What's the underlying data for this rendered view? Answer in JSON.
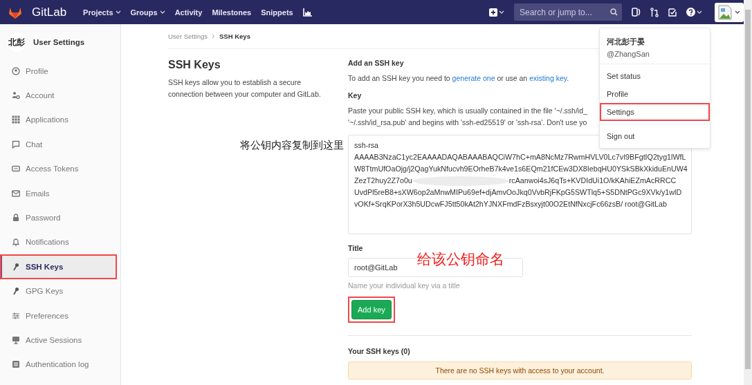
{
  "navbar": {
    "brand": "GitLab",
    "links": [
      {
        "label": "Projects",
        "dropdown": true
      },
      {
        "label": "Groups",
        "dropdown": true
      },
      {
        "label": "Activity",
        "dropdown": false
      },
      {
        "label": "Milestones",
        "dropdown": false
      },
      {
        "label": "Snippets",
        "dropdown": false
      }
    ],
    "search": {
      "placeholder": "Search or jump to..."
    }
  },
  "sidebar": {
    "avatar_text": "北彭",
    "title": "User Settings",
    "items": [
      {
        "label": "Profile",
        "kind": "profile",
        "selected": false,
        "annotated": false
      },
      {
        "label": "Account",
        "kind": "account",
        "selected": false,
        "annotated": false
      },
      {
        "label": "Applications",
        "kind": "applications",
        "selected": false,
        "annotated": false
      },
      {
        "label": "Chat",
        "kind": "chat",
        "selected": false,
        "annotated": false
      },
      {
        "label": "Access Tokens",
        "kind": "token",
        "selected": false,
        "annotated": false
      },
      {
        "label": "Emails",
        "kind": "email",
        "selected": false,
        "annotated": false
      },
      {
        "label": "Password",
        "kind": "lock",
        "selected": false,
        "annotated": false
      },
      {
        "label": "Notifications",
        "kind": "bell",
        "selected": false,
        "annotated": false
      },
      {
        "label": "SSH Keys",
        "kind": "key",
        "selected": true,
        "annotated": true
      },
      {
        "label": "GPG Keys",
        "kind": "key",
        "selected": false,
        "annotated": false
      },
      {
        "label": "Preferences",
        "kind": "sliders",
        "selected": false,
        "annotated": false
      },
      {
        "label": "Active Sessions",
        "kind": "monitor",
        "selected": false,
        "annotated": false
      },
      {
        "label": "Authentication log",
        "kind": "log",
        "selected": false,
        "annotated": false
      }
    ]
  },
  "breadcrumbs": [
    "User Settings",
    "SSH Keys"
  ],
  "intro": {
    "title": "SSH Keys",
    "description": "SSH keys allow you to establish a secure connection between your computer and GitLab."
  },
  "form": {
    "heading": "Add an SSH key",
    "help": {
      "before": "To add an SSH key you need to ",
      "link1": "generate one",
      "middle": " or use an ",
      "link2": "existing key",
      "after": "."
    },
    "key_label": "Key",
    "key_help": [
      "Paste your public SSH key, which is usually contained in the file '~/.ssh/id_",
      "'~/.ssh/id_rsa.pub' and begins with 'ssh-ed25519' or 'ssh-rsa'. Don't use yo"
    ],
    "key_annotation": "将公钥内容复制到这里",
    "key_lines": [
      {
        "segments": [
          "ssh-rsa"
        ]
      },
      {
        "segments": [
          "AAAAB3NzaC1yc2EAAAADAQABAAABAQCiW7hC+mA8NcMz7RwmHVLV0Lc7vI9BFgtIQ2tyg1lWfL"
        ]
      },
      {
        "segments": [
          "W8TtmUfOaOjg/j2QagYukNfucvh9EOrheB7k4ve1s6EQm21fCEw3DX8IebqHU0YSkSBkXkiduEnUW4"
        ]
      },
      {
        "segments": [
          "ZezT2huy2Z7o0u",
          "rcAanwoi4sJ6qTs+KVDIdUi1O/kKAhiEZmAcRRCC"
        ]
      },
      {
        "segments": [
          "UvdPl5reB8+sXW6op2aMnwMIPu69ef+djAmvOoJkq0VvbRjFKpG5SWTlq5+S5DNtPGc9XVk/y1wlD"
        ]
      },
      {
        "segments": [
          "vOKf+SrqKPorX3h5UDcwFJ5tt50kAt2hYJNXFmdFzBsxyjt00O2EtNfNxcjFc66zsB/ root@GitLab"
        ]
      }
    ],
    "title_label": "Title",
    "title_value": "root@GitLab",
    "title_annotation": "给该公钥命名",
    "title_hint": "Name your individual key via a title",
    "submit": {
      "label": "Add key",
      "annotated": true
    }
  },
  "keys": {
    "heading": "Your SSH keys (0)",
    "empty": "There are no SSH keys with access to your account."
  },
  "user_menu": {
    "name": "河北彭于晏",
    "handle": "@ZhangSan",
    "items": [
      {
        "label": "Set status",
        "annotated": false
      },
      {
        "label": "Profile",
        "annotated": false
      },
      {
        "label": "Settings",
        "annotated": true
      }
    ],
    "footer_items": [
      {
        "label": "Sign out",
        "annotated": false
      }
    ]
  }
}
